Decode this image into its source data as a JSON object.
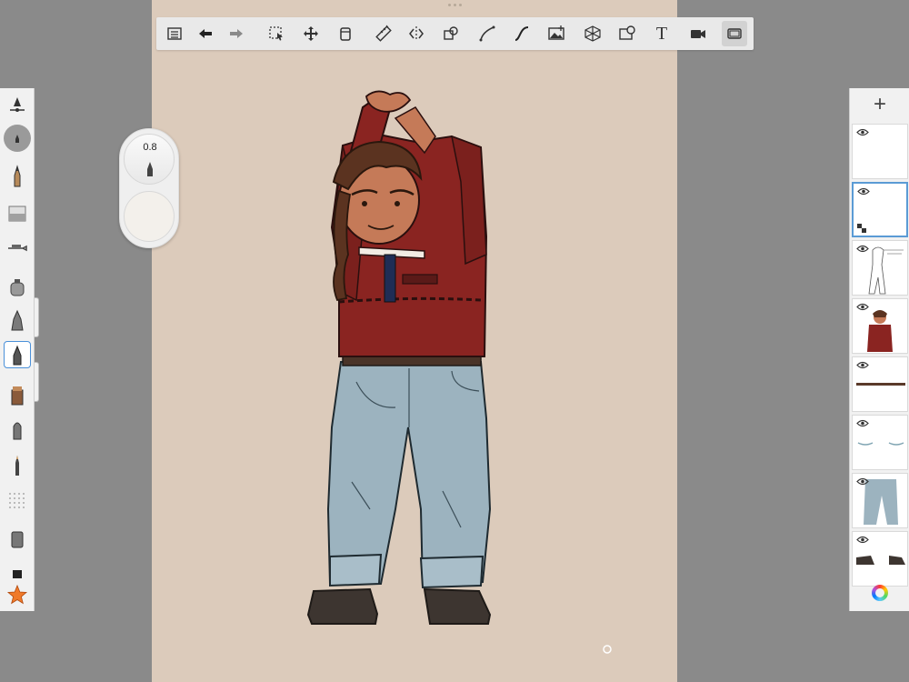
{
  "toolbar": {
    "items": [
      {
        "name": "layers-list-icon"
      },
      {
        "name": "undo-icon"
      },
      {
        "name": "redo-icon"
      },
      {
        "name": "selection-icon"
      },
      {
        "name": "transform-icon"
      },
      {
        "name": "fill-bucket-icon"
      },
      {
        "name": "ruler-icon"
      },
      {
        "name": "symmetry-icon"
      },
      {
        "name": "stroke-icon"
      },
      {
        "name": "curve-icon"
      },
      {
        "name": "steady-stroke-icon"
      },
      {
        "name": "import-image-icon"
      },
      {
        "name": "perspective-icon"
      },
      {
        "name": "predictive-stroke-icon"
      },
      {
        "name": "text-icon",
        "label": "T"
      },
      {
        "name": "time-lapse-icon"
      },
      {
        "name": "fullscreen-icon"
      }
    ]
  },
  "puck": {
    "size_value": "0.8"
  },
  "brushes": {
    "selected_index": 7,
    "items": [
      "brush-settings-icon",
      "color-puck-icon",
      "pencil-icon",
      "eraser-icon",
      "airbrush-icon",
      "paint-brush-icon",
      "ink-pen-icon",
      "fine-pen-icon",
      "chisel-brush-icon",
      "marker-icon",
      "calligraphy-icon",
      "texture-dots-icon",
      "bucket-brush-icon",
      "square-brush-icon",
      "favorite-star-icon"
    ]
  },
  "layers": {
    "add_label": "+",
    "selected_index": 1,
    "items": [
      {
        "name": "layer-1",
        "visible": true
      },
      {
        "name": "layer-2",
        "visible": true
      },
      {
        "name": "layer-3-sketch",
        "visible": true
      },
      {
        "name": "layer-4-color",
        "visible": true
      },
      {
        "name": "layer-5-belt",
        "visible": true
      },
      {
        "name": "layer-6-cuffs",
        "visible": true
      },
      {
        "name": "layer-7-jeans",
        "visible": true
      },
      {
        "name": "layer-8-boots",
        "visible": true
      }
    ]
  },
  "colors": {
    "canvas": "#dccbbb",
    "jacket": "#8a2421",
    "jeans": "#9cb3bf",
    "boots": "#3d3530",
    "skin": "#c57a58",
    "hair": "#5b3320",
    "selection": "#5a9bd5"
  }
}
